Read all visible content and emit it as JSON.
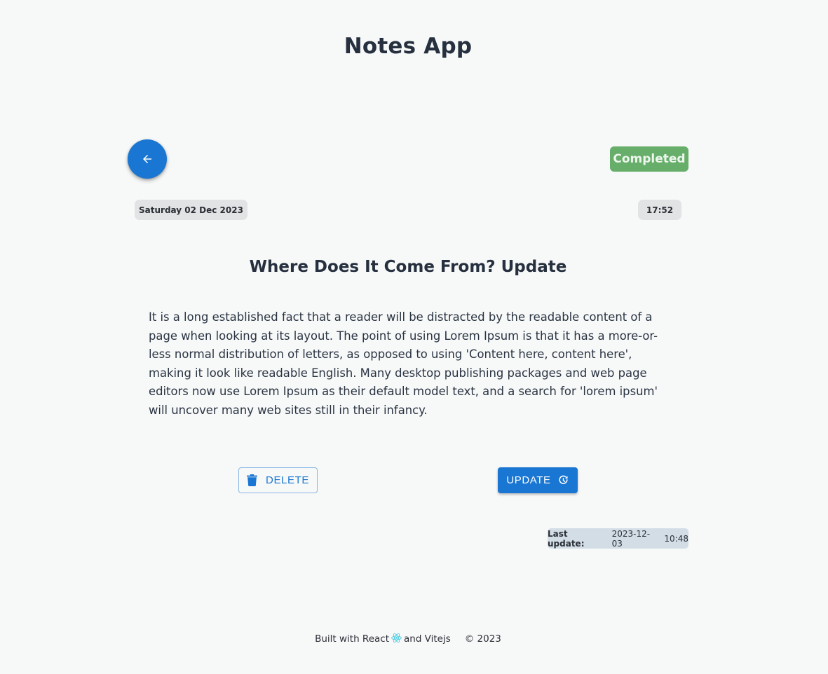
{
  "header": {
    "title": "Notes App"
  },
  "note": {
    "status": "Completed",
    "date": "Saturday 02 Dec 2023",
    "time": "17:52",
    "title": "Where Does It Come From? Update",
    "body": "It is a long established fact that a reader will be distracted by the readable content of a page when looking at its layout. The point of using Lorem Ipsum is that it has a more-or-less normal distribution of letters, as opposed to using 'Content here, content here', making it look like readable English. Many desktop publishing packages and web page editors now use Lorem Ipsum as their default model text, and a search for 'lorem ipsum' will uncover many web sites still in their infancy."
  },
  "actions": {
    "delete_label": "DELETE",
    "update_label": "UPDATE"
  },
  "last_update": {
    "label": "Last update:",
    "date": "2023-12-03",
    "time": "10:48"
  },
  "footer": {
    "built_with": "Built with React",
    "and_vite": "and Vitejs",
    "copyright": "© 2023"
  },
  "icons": {
    "back": "arrow-left-icon",
    "delete": "trash-icon",
    "update": "refresh-icon",
    "react": "react-logo-icon"
  },
  "colors": {
    "primary": "#1976d2",
    "status_completed": "#66ae69",
    "background": "#f7f8f8",
    "text": "#26303e"
  }
}
